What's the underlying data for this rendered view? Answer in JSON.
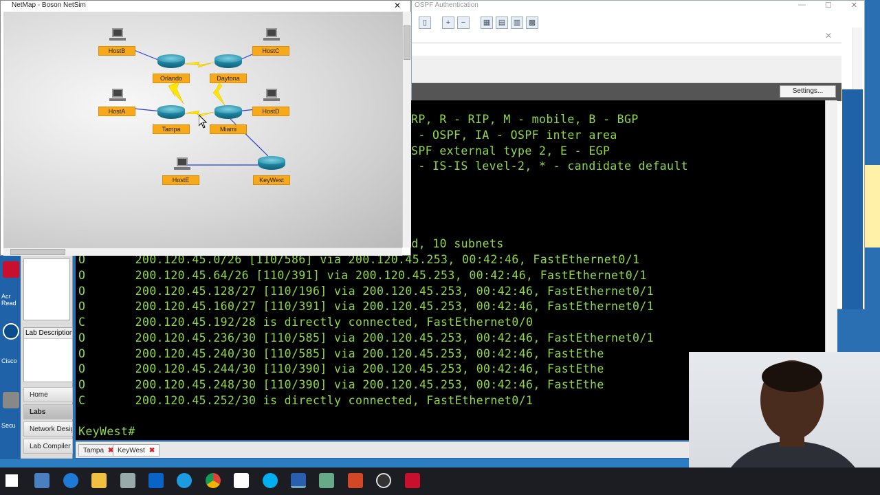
{
  "netmap": {
    "title": "NetMap - Boson NetSim",
    "close_glyph": "✕",
    "devices": {
      "hostb": "HostB",
      "hostc": "HostC",
      "orlando": "Orlando",
      "daytona": "Daytona",
      "hosta": "HostA",
      "hostd": "HostD",
      "tampa": "Tampa",
      "miami": "Miami",
      "hoste": "HostE",
      "keywest": "KeyWest"
    },
    "colors": {
      "label_bg": "#f7a81b",
      "serial_link": "#ffe600",
      "ethernet_link": "#2a3fd0"
    }
  },
  "background_window": {
    "title": "OSPF Authentication",
    "settings_label": "Settings..."
  },
  "lab_panel": {
    "description_title": "Lab Description",
    "nav": [
      "Home",
      "Labs",
      "Network Design",
      "Lab Compiler"
    ]
  },
  "terminal": {
    "lines": [
      "RP, R - RIP, M - mobile, B - BGP",
      " - OSPF, IA - OSPF inter area",
      "SPF external type 2, E - EGP",
      " - IS-IS level-2, * - candidate default",
      "ed, 10 subnets",
      "O       200.120.45.0/26 [110/586] via 200.120.45.253, 00:42:46, FastEthernet0/1",
      "O       200.120.45.64/26 [110/391] via 200.120.45.253, 00:42:46, FastEthernet0/1",
      "O       200.120.45.128/27 [110/196] via 200.120.45.253, 00:42:46, FastEthernet0/1",
      "O       200.120.45.160/27 [110/391] via 200.120.45.253, 00:42:46, FastEthernet0/1",
      "C       200.120.45.192/28 is directly connected, FastEthernet0/0",
      "O       200.120.45.236/30 [110/585] via 200.120.45.253, 00:42:46, FastEthernet0/1",
      "O       200.120.45.240/30 [110/585] via 200.120.45.253, 00:42:46, FastEthe",
      "O       200.120.45.244/30 [110/390] via 200.120.45.253, 00:42:46, FastEthe",
      "O       200.120.45.248/30 [110/390] via 200.120.45.253, 00:42:46, FastEthe",
      "C       200.120.45.252/30 is directly connected, FastEthernet0/1",
      "KeyWest#"
    ],
    "text_color": "#8fd84a"
  },
  "session_tabs": [
    {
      "label": "Tampa",
      "close": "✖"
    },
    {
      "label": "KeyWest",
      "close": "✖"
    }
  ],
  "desktop": {
    "labels": [
      "Acr Read",
      "Cisco",
      "Secu"
    ]
  }
}
